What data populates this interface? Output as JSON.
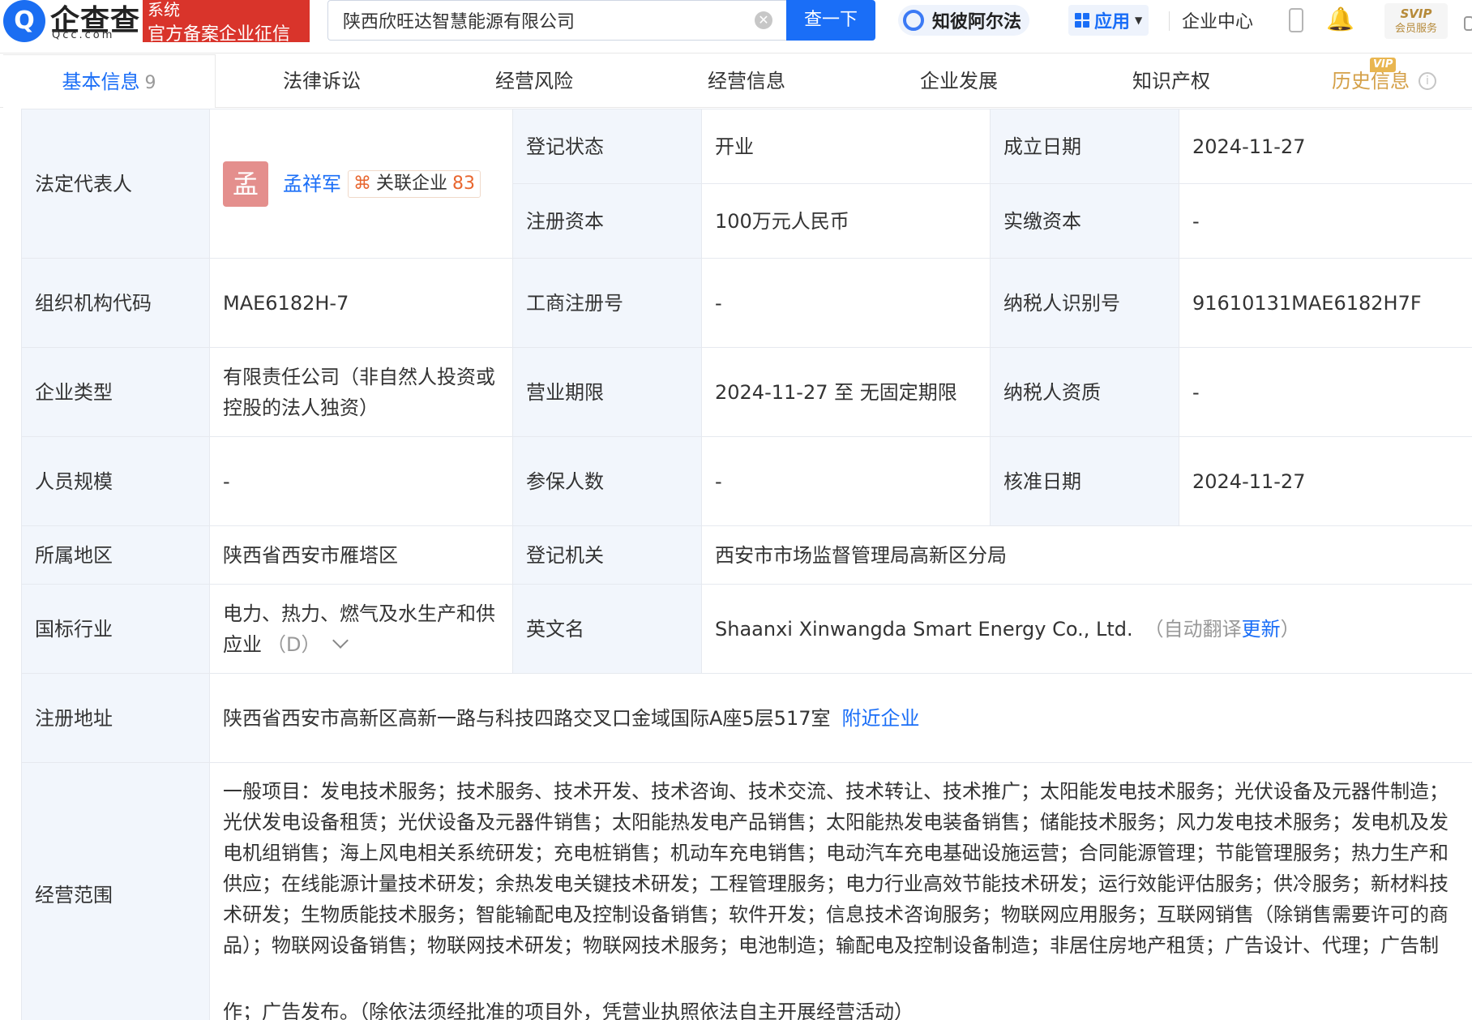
{
  "header": {
    "logo_glyph": "Q",
    "logo_text": "企查查",
    "logo_url": "Qcc.com",
    "badge_line1": "系统",
    "badge_line2": "官方备案企业征信",
    "search_value": "陕西欣旺达智慧能源有限公司",
    "clear_glyph": "✕",
    "search_button": "查一下",
    "ai_label": "知彼阿尔法",
    "apps_label": "应用",
    "apps_caret": "▼",
    "enterprise_center": "企业中心",
    "bell_glyph": "🔔",
    "svip_top": "SVIP",
    "svip_bottom": "会员服务"
  },
  "tabs": {
    "basic": "基本信息",
    "basic_count": "9",
    "legal": "法律诉讼",
    "risk": "经营风险",
    "ops": "经营信息",
    "dev": "企业发展",
    "ip": "知识产权",
    "history": "历史信息",
    "vip_tag": "VIP",
    "info_glyph": "i"
  },
  "company": {
    "legal_rep_label": "法定代表人",
    "legal_rep_avatar": "孟",
    "legal_rep_name": "孟祥军",
    "related_icon": "⌘",
    "related_label": "关联企业",
    "related_count": "83",
    "status_label": "登记状态",
    "status_value": "开业",
    "established_label": "成立日期",
    "established_value": "2024-11-27",
    "reg_capital_label": "注册资本",
    "reg_capital_value": "100万元人民币",
    "paid_capital_label": "实缴资本",
    "paid_capital_value": "-",
    "org_code_label": "组织机构代码",
    "org_code_value": "MAE6182H-7",
    "biz_reg_no_label": "工商注册号",
    "biz_reg_no_value": "-",
    "taxpayer_id_label": "纳税人识别号",
    "taxpayer_id_value": "91610131MAE6182H7F",
    "type_label": "企业类型",
    "type_value": "有限责任公司（非自然人投资或控股的法人独资）",
    "term_label": "营业期限",
    "term_value": "2024-11-27 至 无固定期限",
    "taxpayer_qual_label": "纳税人资质",
    "taxpayer_qual_value": "-",
    "staff_label": "人员规模",
    "staff_value": "-",
    "insured_label": "参保人数",
    "insured_value": "-",
    "approved_label": "核准日期",
    "approved_value": "2024-11-27",
    "region_label": "所属地区",
    "region_value": "陕西省西安市雁塔区",
    "authority_label": "登记机关",
    "authority_value": "西安市市场监督管理局高新区分局",
    "industry_label": "国标行业",
    "industry_value": "电力、热力、燃气及水生产和供应业",
    "industry_code": "（D）",
    "en_name_label": "英文名",
    "en_name_value": "Shaanxi Xinwangda Smart Energy Co., Ltd.",
    "en_note_open": "（自动翻译",
    "en_update": "更新",
    "en_note_close": "）",
    "address_label": "注册地址",
    "address_value": "陕西省西安市高新区高新一路与科技四路交叉口金域国际A座5层517室",
    "nearby_link": "附近企业",
    "scope_label": "经营范围",
    "scope_value": "一般项目：发电技术服务；技术服务、技术开发、技术咨询、技术交流、技术转让、技术推广；太阳能发电技术服务；光伏设备及元器件制造；光伏发电设备租赁；光伏设备及元器件销售；太阳能热发电产品销售；太阳能热发电装备销售；储能技术服务；风力发电技术服务；发电机及发电机组销售；海上风电相关系统研发；充电桩销售；机动车充电销售；电动汽车充电基础设施运营；合同能源管理；节能管理服务；热力生产和供应；在线能源计量技术研发；余热发电关键技术研发；工程管理服务；电力行业高效节能技术研发；运行效能评估服务；供冷服务；新材料技术研发；生物质能技术服务；智能输配电及控制设备销售；软件开发；信息技术咨询服务；物联网应用服务；互联网销售（除销售需要许可的商品）；物联网设备销售；物联网技术研发；物联网技术服务；电池制造；输配电及控制设备制造；非居住房地产租赁；广告设计、代理；广告制",
    "scope_tail": "作；广告发布。（除依法须经批准的项目外，凭营业执照依法自主开展经营活动）"
  }
}
